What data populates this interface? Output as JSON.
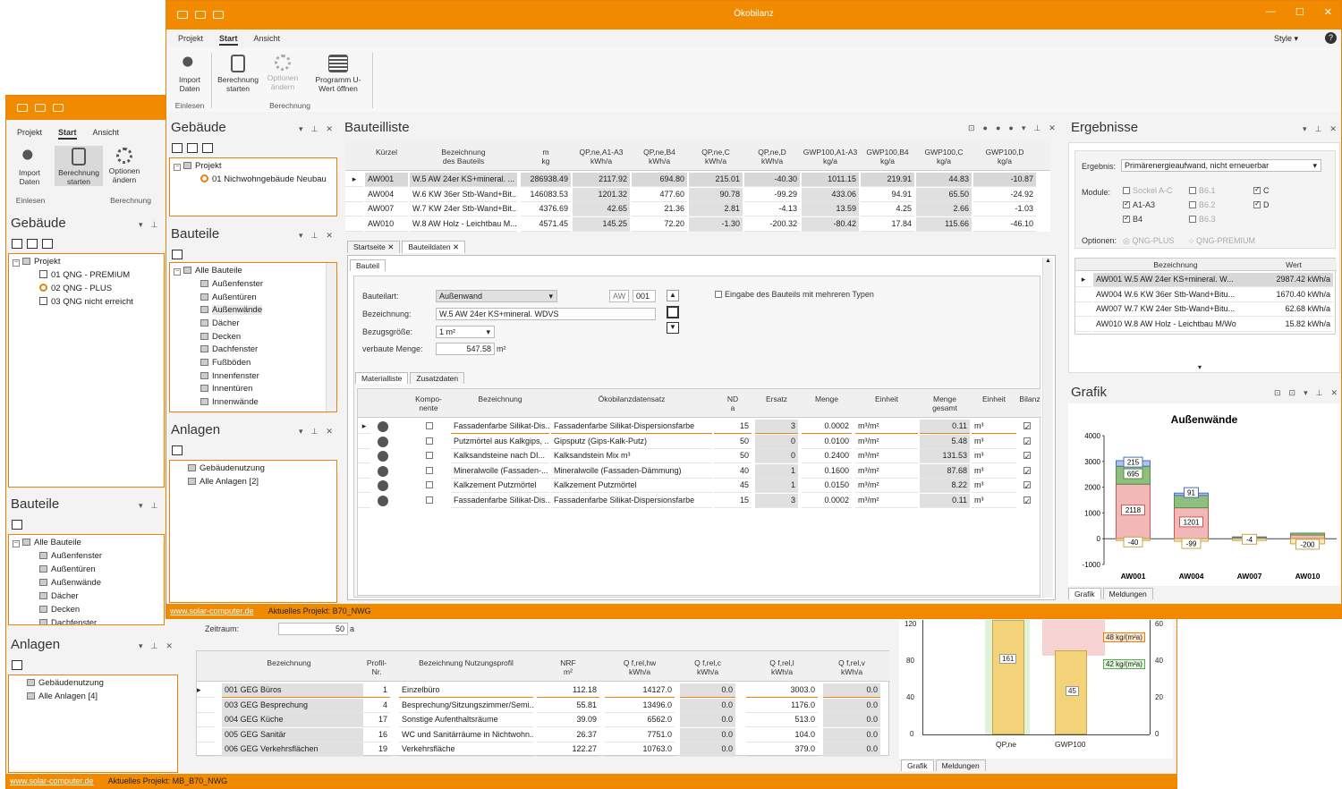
{
  "back": {
    "menu": [
      "Projekt",
      "Start",
      "Ansicht"
    ],
    "ribbon": {
      "import": "Import Daten",
      "calc": "Berechnung starten",
      "opts": "Optionen ändern",
      "group1": "Einlesen",
      "group2": "Berechnung"
    },
    "gebaeude": {
      "title": "Gebäude",
      "items": [
        "Projekt",
        "01 QNG - PREMIUM",
        "02 QNG - PLUS",
        "03 QNG nicht erreicht"
      ]
    },
    "bauteile": {
      "title": "Bauteile",
      "items": [
        "Alle Bauteile",
        "Außenfenster",
        "Außentüren",
        "Außenwände",
        "Dächer",
        "Decken",
        "Dachfenster"
      ]
    },
    "anlagen": {
      "title": "Anlagen",
      "items": [
        "Gebäudenutzung",
        "Alle Anlagen [4]"
      ]
    },
    "zeitraum_label": "Zeitraum:",
    "zeitraum_val": "50",
    "zeitraum_unit": "a",
    "table": {
      "headers": [
        "Bezeichnung",
        "Profil-\nNr.",
        "Bezeichnung Nutzungsprofil",
        "NRF\nm²",
        "Q f,rel,hw\nkWh/a",
        "Q f,rel,c\nkWh/a",
        "Q f,rel,l\nkWh/a",
        "Q f,rel,v\nkWh/a"
      ],
      "rows": [
        [
          "001 GEG Büros",
          "1",
          "Einzelbüro",
          "112.18",
          "14127.0",
          "0.0",
          "3003.0",
          "0.0"
        ],
        [
          "003 GEG Besprechung",
          "4",
          "Besprechung/Sitzungszimmer/Semi...",
          "55.81",
          "13496.0",
          "0.0",
          "1176.0",
          "0.0"
        ],
        [
          "004 GEG Küche",
          "17",
          "Sonstige Aufenthaltsräume",
          "39.09",
          "6562.0",
          "0.0",
          "513.0",
          "0.0"
        ],
        [
          "005 GEG Sanitär",
          "16",
          "WC und Sanitärräume in Nichtwohn...",
          "26.37",
          "7751.0",
          "0.0",
          "104.0",
          "0.0"
        ],
        [
          "006 GEG Verkehrsflächen",
          "19",
          "Verkehrsfläche",
          "122.27",
          "10763.0",
          "0.0",
          "379.0",
          "0.0"
        ]
      ]
    },
    "chart": {
      "yticks": [
        "120",
        "80",
        "40",
        "0"
      ],
      "y2ticks": [
        "60",
        "40",
        "20",
        "0"
      ],
      "bars": [
        "161",
        "45"
      ],
      "labels": [
        "QP,ne",
        "GWP100"
      ],
      "badges": [
        "48 kg/(m²a)",
        "42 kg/(m²a)"
      ]
    },
    "tabs": [
      "Grafik",
      "Meldungen"
    ],
    "status": {
      "link": "www.solar-computer.de",
      "proj": "Aktuelles Projekt: MB_B70_NWG"
    }
  },
  "main": {
    "title": "Ökobilanz",
    "menu": [
      "Projekt",
      "Start",
      "Ansicht"
    ],
    "style": "Style",
    "ribbon": {
      "import": "Import Daten",
      "calc": "Berechnung starten",
      "opts": "Optionen ändern",
      "prog": "Programm U-Wert öffnen",
      "group1": "Einlesen",
      "group2": "Berechnung"
    },
    "gebaeude": {
      "title": "Gebäude",
      "items": [
        "Projekt",
        "01 Nichwohngebäude Neubau"
      ]
    },
    "bauteile": {
      "title": "Bauteile",
      "items": [
        "Alle Bauteile",
        "Außenfenster",
        "Außentüren",
        "Außenwände",
        "Dächer",
        "Decken",
        "Dachfenster",
        "Fußböden",
        "Innenfenster",
        "Innentüren",
        "Innenwände"
      ]
    },
    "anlagen": {
      "title": "Anlagen",
      "items": [
        "Gebäudenutzung",
        "Alle Anlagen [2]"
      ]
    },
    "bauteilliste": {
      "title": "Bauteilliste",
      "headers": [
        "Kürzel",
        "Bezeichnung\ndes Bauteils",
        "m\nkg",
        "QP,ne,A1-A3\nkWh/a",
        "QP,ne,B4\nkWh/a",
        "QP,ne,C\nkWh/a",
        "QP,ne,D\nkWh/a",
        "GWP100,A1-A3\nkg/a",
        "GWP100,B4\nkg/a",
        "GWP100,C\nkg/a",
        "GWP100,D\nkg/a"
      ],
      "rows": [
        [
          "AW001",
          "W.5 AW 24er KS+mineral. ...",
          "286938.49",
          "2117.92",
          "694.80",
          "215.01",
          "-40.30",
          "1011.15",
          "219.91",
          "44.83",
          "-10.87"
        ],
        [
          "AW004",
          "W.6 KW 36er Stb-Wand+Bit...",
          "146083.53",
          "1201.32",
          "477.60",
          "90.78",
          "-99.29",
          "433.06",
          "94.91",
          "65.50",
          "-24.92"
        ],
        [
          "AW007",
          "W.7 KW 24er Stb-Wand+Bit...",
          "4376.69",
          "42.65",
          "21.36",
          "2.81",
          "-4.13",
          "13.59",
          "4.25",
          "2.66",
          "-1.03"
        ],
        [
          "AW010",
          "W.8 AW Holz - Leichtbau M...",
          "4571.45",
          "145.25",
          "72.20",
          "-1.30",
          "-200.32",
          "-80.42",
          "17.84",
          "115.66",
          "-46.10"
        ]
      ]
    },
    "doctabs": [
      "Startseite",
      "Bauteildaten"
    ],
    "bauteil": {
      "tab": "Bauteil",
      "art_label": "Bauteilart:",
      "art_val": "Außenwand",
      "code1": "AW",
      "code2": "001",
      "bez_label": "Bezeichnung:",
      "bez_val": "W.5 AW 24er KS+mineral. WDVS",
      "bezug_label": "Bezugsgröße:",
      "bezug_val": "1 m²",
      "menge_label": "verbaute Menge:",
      "menge_val": "547.58",
      "menge_unit": "m²",
      "multi": "Eingabe des Bauteils mit mehreren Typen"
    },
    "mattabs": [
      "Materialliste",
      "Zusatzdaten"
    ],
    "mat": {
      "headers": [
        "Kompo-\nnente",
        "Bezeichnung",
        "Ökobilanzdatensatz",
        "ND\na",
        "Ersatz",
        "Menge",
        "Einheit",
        "Menge\ngesamt",
        "Einheit",
        "Bilanz"
      ],
      "rows": [
        [
          "Fassadenfarbe Silikat-Dis...",
          "Fassadenfarbe Silikat-Dispersionsfarbe",
          "15",
          "3",
          "0.0002",
          "m³/m²",
          "0.11",
          "m³"
        ],
        [
          "Putzmörtel aus Kalkgips, ...",
          "Gipsputz (Gips-Kalk-Putz)",
          "50",
          "0",
          "0.0100",
          "m³/m²",
          "5.48",
          "m³"
        ],
        [
          "Kalksandsteine nach DI...",
          "Kalksandstein Mix m³",
          "50",
          "0",
          "0.2400",
          "m³/m²",
          "131.53",
          "m³"
        ],
        [
          "Mineralwolle (Fassaden-...",
          "Mineralwolle (Fassaden-Dämmung)",
          "40",
          "1",
          "0.1600",
          "m³/m²",
          "87.68",
          "m³"
        ],
        [
          "Kalkzement Putzmörtel",
          "Kalkzement Putzmörtel",
          "45",
          "1",
          "0.0150",
          "m³/m²",
          "8.22",
          "m³"
        ],
        [
          "Fassadenfarbe Silikat-Dis...",
          "Fassadenfarbe Silikat-Dispersionsfarbe",
          "15",
          "3",
          "0.0002",
          "m³/m²",
          "0.11",
          "m³"
        ]
      ]
    },
    "ergebnisse": {
      "title": "Ergebnisse",
      "erg_label": "Ergebnis:",
      "erg_val": "Primärenergieaufwand, nicht erneuerbar",
      "mod_label": "Module:",
      "modules": [
        "Sockel A-C",
        "B6.1",
        "C",
        "A1-A3",
        "B6.2",
        "D",
        "B4",
        "B6.3"
      ],
      "opt_label": "Optionen:",
      "opts": [
        "QNG-PLUS",
        "QNG-PREMIUM"
      ],
      "headers": [
        "Bezeichnung",
        "Wert"
      ],
      "rows": [
        [
          "AW001 W.5 AW 24er KS+mineral. W...",
          "2987.42 kWh/a"
        ],
        [
          "AW004 W.6 KW 36er Stb-Wand+Bitu...",
          "1670.40 kWh/a"
        ],
        [
          "AW007 W.7 KW 24er Stb-Wand+Bitu...",
          "62.68 kWh/a"
        ],
        [
          "AW010 W.8 AW Holz - Leichtbau M/Wo",
          "15.82 kWh/a"
        ]
      ]
    },
    "grafik": {
      "title": "Grafik"
    },
    "tabs": [
      "Grafik",
      "Meldungen"
    ],
    "status": {
      "link": "www.solar-computer.de",
      "proj": "Aktuelles Projekt: B70_NWG"
    }
  },
  "chart_data": {
    "type": "bar",
    "title": "Außenwände",
    "categories": [
      "AW001",
      "AW004",
      "AW007",
      "AW010"
    ],
    "ylim": [
      -1000,
      4000
    ],
    "yticks": [
      "4000",
      "3000",
      "2000",
      "1000",
      "0",
      "-1000"
    ],
    "series": [
      {
        "values": [
          2118,
          1201,
          43,
          145
        ]
      },
      {
        "values": [
          695,
          478,
          21,
          72
        ]
      },
      {
        "values": [
          215,
          91,
          3,
          -1
        ]
      },
      {
        "values": [
          -40,
          -99,
          -4,
          -200
        ]
      }
    ],
    "labels": [
      [
        "2118",
        "695",
        "215",
        "-40"
      ],
      [
        "1201",
        "91",
        "-99"
      ],
      [
        "-4"
      ],
      [
        "-200"
      ]
    ]
  },
  "colors": {
    "accent": "#f28a00"
  }
}
